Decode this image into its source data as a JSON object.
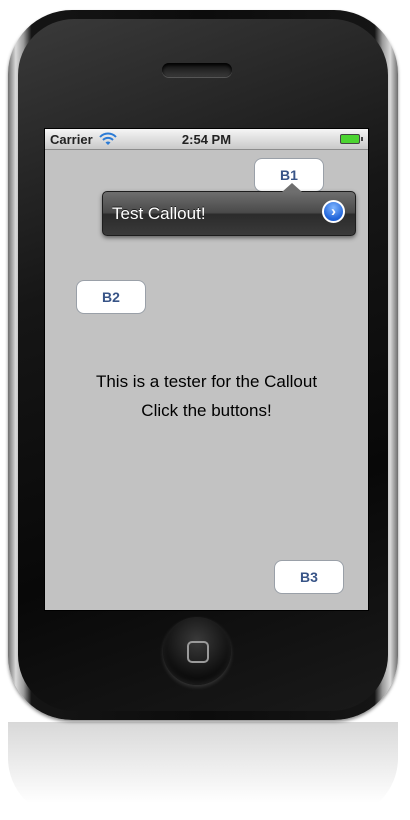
{
  "status_bar": {
    "carrier": "Carrier",
    "time": "2:54 PM",
    "wifi_icon": "wifi-icon",
    "battery_icon": "battery-full-icon",
    "battery_color": "#4cd431"
  },
  "buttons": {
    "b1": "B1",
    "b2": "B2",
    "b3": "B3"
  },
  "callout": {
    "text": "Test Callout!",
    "accessory_icon": "chevron-right-circle-icon",
    "accessory_glyph": "›"
  },
  "message": {
    "line1": "This is a tester for the Callout",
    "line2": "Click the buttons!"
  },
  "colors": {
    "screen_background": "#c2c2c2",
    "button_text": "#385487",
    "disclosure_blue": "#1f63d8"
  }
}
